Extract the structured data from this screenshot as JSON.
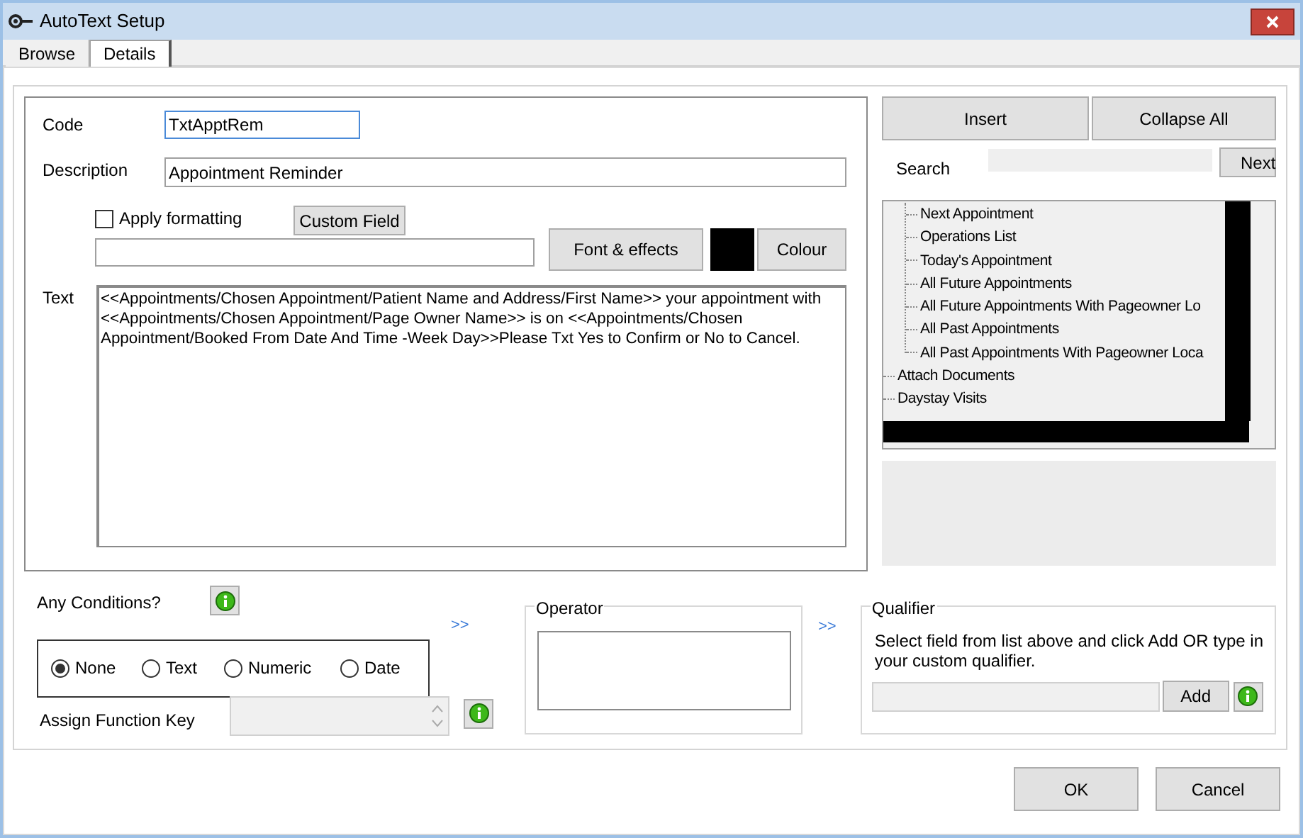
{
  "window": {
    "title": "AutoText Setup"
  },
  "tabs": [
    {
      "label": "Browse",
      "selected": false
    },
    {
      "label": "Details",
      "selected": true
    }
  ],
  "form": {
    "code_label": "Code",
    "code_value": "TxtApptRem",
    "description_label": "Description",
    "description_value": "Appointment Reminder",
    "apply_formatting": {
      "label": "Apply formatting",
      "checked": false
    },
    "custom_field_button": "Custom Field",
    "font_button": "Font & effects",
    "colour_button": "Colour",
    "text_label": "Text",
    "text_value": "<<Appointments/Chosen Appointment/Patient Name and Address/First Name>> your appointment with <<Appointments/Chosen Appointment/Page Owner Name>> is on <<Appointments/Chosen Appointment/Booked From Date And Time -Week Day>>Please Txt Yes to Confirm or No to Cancel."
  },
  "right_panel": {
    "insert_button": "Insert",
    "collapse_button": "Collapse All",
    "search_label": "Search",
    "next_button": "Next",
    "tree": [
      {
        "children": [
          {
            "label": "Next Appointment"
          },
          {
            "label": "Operations List"
          },
          {
            "label": "Today's Appointment"
          },
          {
            "label": "All Future Appointments"
          },
          {
            "label": "All Future Appointments With Pageowner Lo"
          },
          {
            "label": "All Past Appointments"
          },
          {
            "label": "All Past Appointments With Pageowner Loca"
          }
        ]
      },
      {
        "label": "Attach Documents"
      },
      {
        "label": "Daystay Visits"
      }
    ]
  },
  "conditions": {
    "label": "Any Conditions?",
    "options": [
      {
        "label": "None",
        "selected": true
      },
      {
        "label": "Text",
        "selected": false
      },
      {
        "label": "Numeric",
        "selected": false
      },
      {
        "label": "Date",
        "selected": false
      }
    ],
    "arrow_1": ">>",
    "arrow_2": ">>",
    "function_key_label": "Assign Function Key"
  },
  "operator": {
    "title": "Operator"
  },
  "qualifier": {
    "title": "Qualifier",
    "hint": "Select field from list above and click Add OR type in your custom qualifier.",
    "add_button": "Add"
  },
  "buttons": [
    "OK",
    "Cancel"
  ]
}
